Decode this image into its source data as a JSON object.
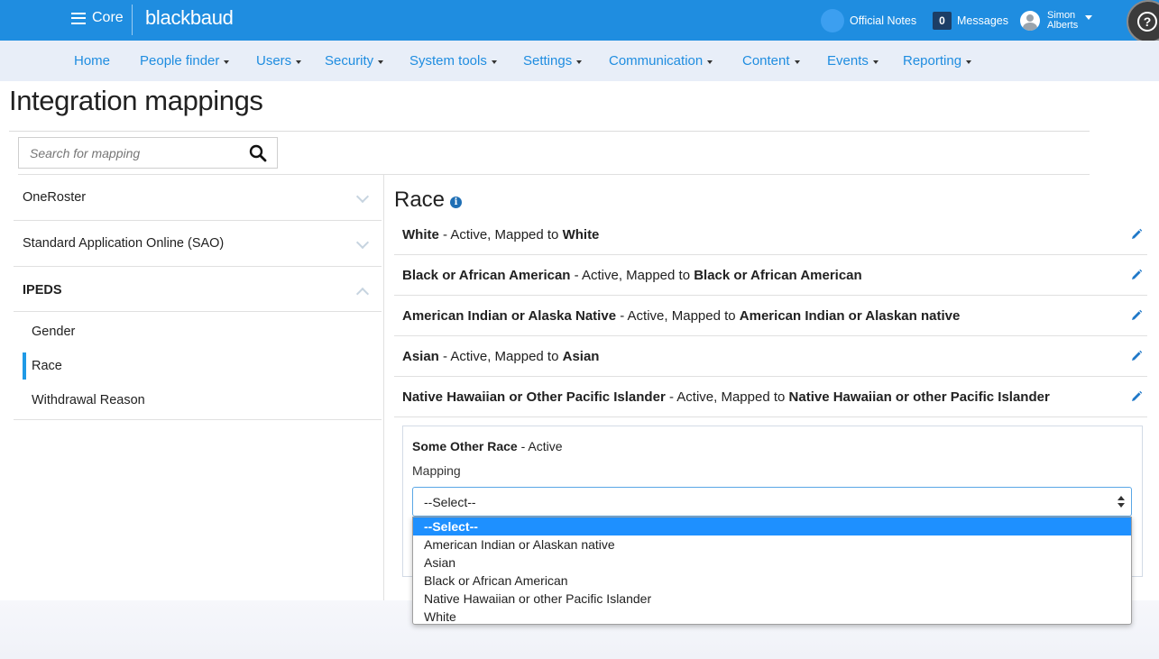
{
  "topbar": {
    "app_name": "Core",
    "brand": "blackbaud",
    "official_notes": "Official Notes",
    "message_count": "0",
    "messages": "Messages",
    "user_first": "Simon",
    "user_last": "Alberts",
    "help": "?"
  },
  "nav": {
    "items": [
      "Home",
      "People finder",
      "Users",
      "Security",
      "System tools",
      "Settings",
      "Communication",
      "Content",
      "Events",
      "Reporting"
    ]
  },
  "page": {
    "title": "Integration mappings",
    "search_placeholder": "Search for mapping"
  },
  "sidebar": {
    "sections": [
      "OneRoster",
      "Standard Application Online (SAO)",
      "IPEDS"
    ],
    "ipeds_items": [
      "Gender",
      "Race",
      "Withdrawal Reason"
    ],
    "active_item": "Race"
  },
  "content": {
    "heading": "Race",
    "rows": [
      {
        "name": "White",
        "status": " - Active, Mapped to ",
        "mapped": "White"
      },
      {
        "name": "Black or African American",
        "status": " - Active, Mapped to ",
        "mapped": "Black or African American"
      },
      {
        "name": "American Indian or Alaska Native",
        "status": " - Active, Mapped to ",
        "mapped": "American Indian or Alaskan native"
      },
      {
        "name": "Asian",
        "status": " - Active, Mapped to ",
        "mapped": "Asian"
      },
      {
        "name": "Native Hawaiian or Other Pacific Islander",
        "status": " - Active, Mapped to ",
        "mapped": "Native Hawaiian or other Pacific Islander"
      }
    ],
    "editing": {
      "name": "Some Other Race",
      "status": " - Active",
      "mapping_label": "Mapping",
      "selected": "--Select--",
      "options": [
        "--Select--",
        "American Indian or Alaskan native",
        "Asian",
        "Black or African American",
        "Native Hawaiian or other Pacific Islander",
        "White"
      ]
    }
  },
  "colors": {
    "topbar": "#1f8de0",
    "nav_bg": "#e8eef8",
    "link": "#1f8de0",
    "dropdown_highlight": "#1e90ff",
    "active_bar": "#1f9ae6"
  }
}
